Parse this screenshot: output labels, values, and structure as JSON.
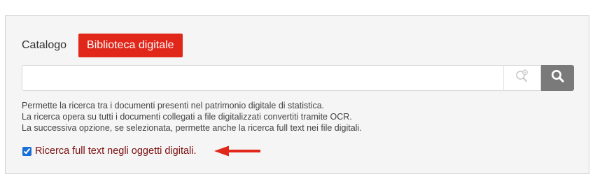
{
  "tabs": {
    "catalog_label": "Catalogo",
    "digital_library_label": "Biblioteca digitale"
  },
  "search": {
    "value": "",
    "placeholder": "",
    "advanced_icon": "magnifier-settings-icon",
    "search_icon": "search-icon"
  },
  "description": {
    "line1": "Permette la ricerca tra i documenti presenti nel patrimonio digitale di statistica.",
    "line2": "La ricerca opera su tutti i documenti collegati a file digitalizzati convertiti tramite OCR.",
    "line3": "La successiva opzione, se selezionata, permette anche la ricerca full text nei file digitali."
  },
  "fulltext_option": {
    "label": "Ricerca full text negli oggetti digitali.",
    "checked": true
  },
  "colors": {
    "accent": "#e0271a",
    "search_button": "#7a7a7a",
    "option_text": "#7a0f0f",
    "arrow": "#e0271a"
  }
}
